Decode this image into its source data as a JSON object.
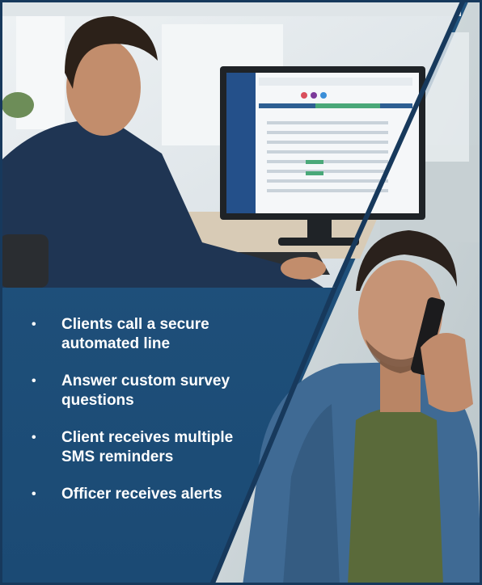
{
  "bullets": [
    {
      "line1": "Clients call a secure",
      "line2": "automated line"
    },
    {
      "line1": "Answer custom survey",
      "line2": "questions"
    },
    {
      "line1": "Client receives multiple",
      "line2": "SMS reminders"
    },
    {
      "line1": "Officer receives alerts",
      "line2": ""
    }
  ],
  "bullet_symbol": "•",
  "colors": {
    "panel_blue": "#1e4f7a",
    "border_navy": "#17395c",
    "accent_green": "#4aa879",
    "text_white": "#ffffff"
  }
}
